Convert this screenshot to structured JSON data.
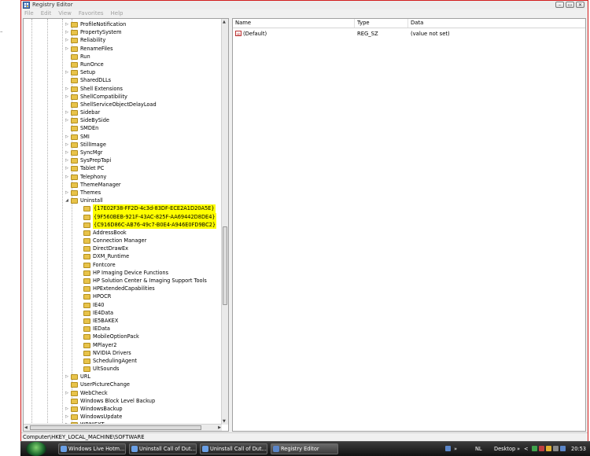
{
  "window": {
    "title": "Registry Editor",
    "min_glyph": "–",
    "max_glyph": "▭",
    "close_glyph": "✕"
  },
  "menu": [
    "File",
    "Edit",
    "View",
    "Favorites",
    "Help"
  ],
  "desktop_mark": "–",
  "tree": {
    "items": [
      {
        "label": "ProfileNotification",
        "indent": 0,
        "expander": "▷"
      },
      {
        "label": "PropertySystem",
        "indent": 0,
        "expander": "▷"
      },
      {
        "label": "Reliability",
        "indent": 0,
        "expander": "▷"
      },
      {
        "label": "RenameFiles",
        "indent": 0,
        "expander": "▷"
      },
      {
        "label": "Run",
        "indent": 0,
        "expander": ""
      },
      {
        "label": "RunOnce",
        "indent": 0,
        "expander": ""
      },
      {
        "label": "Setup",
        "indent": 0,
        "expander": "▷"
      },
      {
        "label": "SharedDLLs",
        "indent": 0,
        "expander": ""
      },
      {
        "label": "Shell Extensions",
        "indent": 0,
        "expander": "▷"
      },
      {
        "label": "ShellCompatibility",
        "indent": 0,
        "expander": "▷"
      },
      {
        "label": "ShellServiceObjectDelayLoad",
        "indent": 0,
        "expander": ""
      },
      {
        "label": "Sidebar",
        "indent": 0,
        "expander": "▷"
      },
      {
        "label": "SideBySide",
        "indent": 0,
        "expander": "▷"
      },
      {
        "label": "SMDEn",
        "indent": 0,
        "expander": ""
      },
      {
        "label": "SMI",
        "indent": 0,
        "expander": "▷"
      },
      {
        "label": "StillImage",
        "indent": 0,
        "expander": "▷"
      },
      {
        "label": "SyncMgr",
        "indent": 0,
        "expander": "▷"
      },
      {
        "label": "SysPrepTapi",
        "indent": 0,
        "expander": "▷"
      },
      {
        "label": "Tablet PC",
        "indent": 0,
        "expander": "▷"
      },
      {
        "label": "Telephony",
        "indent": 0,
        "expander": "▷"
      },
      {
        "label": "ThemeManager",
        "indent": 0,
        "expander": ""
      },
      {
        "label": "Themes",
        "indent": 0,
        "expander": "▷"
      },
      {
        "label": "Uninstall",
        "indent": 0,
        "expander": "◢"
      },
      {
        "label": "{17E02F38-FF2D-4c3d-83DF-ECE2A1D20A5E}",
        "indent": 1,
        "expander": "",
        "highlight": true
      },
      {
        "label": "{9F560BEB-921F-43AC-825F-AA69442D8DE4}",
        "indent": 1,
        "expander": "",
        "highlight": true
      },
      {
        "label": "{C916D86C-AB76-49c7-B0E4-A946E0FD9BC2}",
        "indent": 1,
        "expander": "",
        "highlight": true
      },
      {
        "label": "AddressBook",
        "indent": 1,
        "expander": ""
      },
      {
        "label": "Connection Manager",
        "indent": 1,
        "expander": ""
      },
      {
        "label": "DirectDrawEx",
        "indent": 1,
        "expander": ""
      },
      {
        "label": "DXM_Runtime",
        "indent": 1,
        "expander": ""
      },
      {
        "label": "Fontcore",
        "indent": 1,
        "expander": ""
      },
      {
        "label": "HP Imaging Device Functions",
        "indent": 1,
        "expander": ""
      },
      {
        "label": "HP Solution Center & Imaging Support Tools",
        "indent": 1,
        "expander": ""
      },
      {
        "label": "HPExtendedCapabilities",
        "indent": 1,
        "expander": ""
      },
      {
        "label": "HPOCR",
        "indent": 1,
        "expander": ""
      },
      {
        "label": "IE40",
        "indent": 1,
        "expander": ""
      },
      {
        "label": "IE4Data",
        "indent": 1,
        "expander": ""
      },
      {
        "label": "IE5BAKEX",
        "indent": 1,
        "expander": ""
      },
      {
        "label": "IEData",
        "indent": 1,
        "expander": ""
      },
      {
        "label": "MobileOptionPack",
        "indent": 1,
        "expander": ""
      },
      {
        "label": "MPlayer2",
        "indent": 1,
        "expander": ""
      },
      {
        "label": "NVIDIA Drivers",
        "indent": 1,
        "expander": ""
      },
      {
        "label": "SchedulingAgent",
        "indent": 1,
        "expander": ""
      },
      {
        "label": "UltSounds",
        "indent": 1,
        "expander": ""
      },
      {
        "label": "URL",
        "indent": 0,
        "expander": "▷"
      },
      {
        "label": "UserPictureChange",
        "indent": 0,
        "expander": ""
      },
      {
        "label": "WebCheck",
        "indent": 0,
        "expander": "▷"
      },
      {
        "label": "Windows Block Level Backup",
        "indent": 0,
        "expander": ""
      },
      {
        "label": "WindowsBackup",
        "indent": 0,
        "expander": "▷"
      },
      {
        "label": "WindowsUpdate",
        "indent": 0,
        "expander": "▷"
      },
      {
        "label": "WRNIEXT",
        "indent": 0,
        "expander": "▷"
      }
    ]
  },
  "list": {
    "columns": [
      "Name",
      "Type",
      "Data"
    ],
    "rows": [
      {
        "icon": "ab",
        "name": "(Default)",
        "type": "REG_SZ",
        "data": "(value not set)"
      }
    ]
  },
  "status": "Computer\\HKEY_LOCAL_MACHINE\\SOFTWARE",
  "taskbar": {
    "buttons": [
      {
        "label": "Windows Live Hotm...",
        "active": false
      },
      {
        "label": "Uninstall Call of Dut...",
        "active": false
      },
      {
        "label": "Uninstall Call of Dut...",
        "active": false
      },
      {
        "label": "Registry Editor",
        "active": true
      }
    ],
    "tray": {
      "lang": "NL",
      "toolbar": "Desktop",
      "clock": "20:53",
      "chevron": "»",
      "arrow": "<"
    }
  },
  "colors": {
    "highlight": "#ffff00",
    "window_border": "#d21b1b",
    "folder": "#e8c34a"
  },
  "icons": {
    "app": "registry-icon",
    "folder": "folder-icon",
    "value": "ab-string-icon",
    "start": "windows-start-icon"
  }
}
